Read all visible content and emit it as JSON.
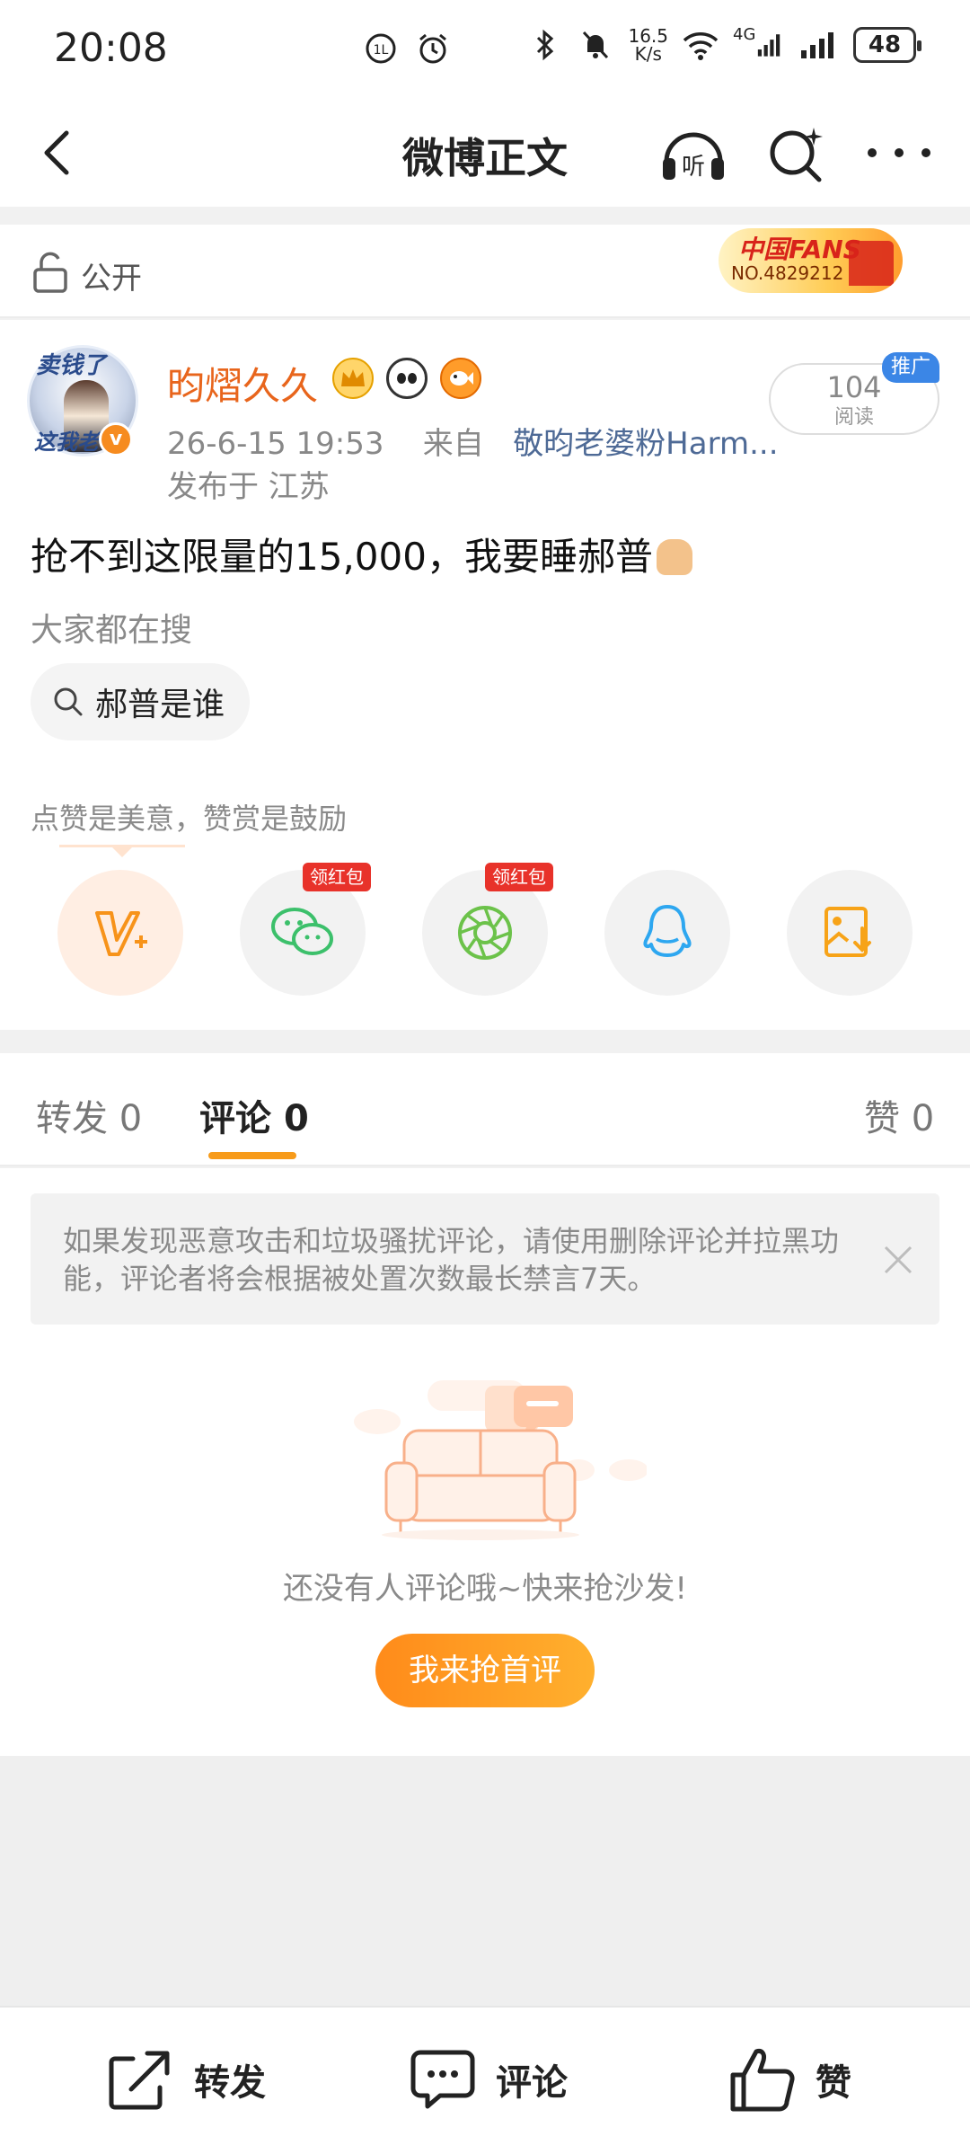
{
  "status_bar": {
    "time": "20:08",
    "net_speed_top": "16.5",
    "net_speed_bottom": "K/s",
    "network": "4G",
    "battery": "48"
  },
  "header": {
    "title": "微博正文",
    "icons": [
      "back-icon",
      "listen-icon",
      "search-icon",
      "more-icon"
    ]
  },
  "visibility": {
    "label": "公开",
    "fans_badge_title": "中国FANS",
    "fans_badge_number": "NO.4829212"
  },
  "post": {
    "avatar_text_top": "卖钱了",
    "avatar_text_bottom": "这我老",
    "verified_mark": "v",
    "username": "昀熠久久",
    "timestamp": "26-6-15 19:53",
    "source_prefix": "来自",
    "source": "敬昀老婆粉Harm...",
    "location": "发布于 江苏",
    "read_count": "104",
    "read_label": "阅读",
    "promo_tag": "推广",
    "text": "抢不到这限量的15,000，我要睡郝普",
    "trending_label": "大家都在搜",
    "trending_chip": "郝普是谁",
    "like_tip": "点赞是美意，赞赏是鼓励",
    "share_buttons": [
      {
        "name": "reward",
        "icon": "v-plus-icon"
      },
      {
        "name": "wechat",
        "icon": "wechat-icon",
        "badge": "领红包"
      },
      {
        "name": "moments",
        "icon": "moments-icon",
        "badge": "领红包"
      },
      {
        "name": "qq",
        "icon": "qq-icon"
      },
      {
        "name": "save-image",
        "icon": "save-image-icon"
      }
    ]
  },
  "tabs": {
    "repost": "转发",
    "repost_count": "0",
    "comment": "评论",
    "comment_count": "0",
    "like": "赞",
    "like_count": "0"
  },
  "comments": {
    "notice": "如果发现恶意攻击和垃圾骚扰评论，请使用删除评论并拉黑功能，评论者将会根据被处置次数最长禁言7天。",
    "empty_text": "还没有人评论哦~快来抢沙发!",
    "first_comment_button": "我来抢首评"
  },
  "bottom_bar": {
    "repost": "转发",
    "comment": "评论",
    "like": "赞"
  },
  "colors": {
    "accent_orange": "#f79b1a",
    "username_orange": "#e8651c",
    "link_blue": "#4e6a96",
    "promo_blue": "#3b86e6",
    "red_badge": "#e8322a"
  }
}
